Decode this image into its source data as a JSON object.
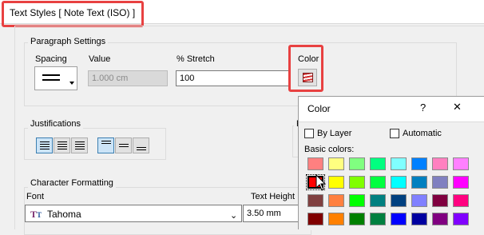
{
  "window": {
    "title": "Text Styles [ Note Text (ISO) ]"
  },
  "paragraph": {
    "group_label": "Paragraph Settings",
    "spacing_label": "Spacing",
    "value_label": "Value",
    "value": "1.000 cm",
    "stretch_label": "% Stretch",
    "stretch_value": "100",
    "color_label": "Color"
  },
  "justifications": {
    "group_label": "Justifications"
  },
  "partial_group_label": "P",
  "character": {
    "group_label": "Character Formatting",
    "font_label": "Font",
    "font_value": "Tahoma",
    "text_height_label": "Text Height",
    "text_height_value": "3.50 mm"
  },
  "color_popup": {
    "title": "Color",
    "help": "?",
    "close": "✕",
    "by_layer": "By Layer",
    "automatic": "Automatic",
    "basic_colors_label": "Basic colors:",
    "swatches": [
      [
        "#ff8080",
        "#ffff80",
        "#80ff80",
        "#00ff80",
        "#80ffff",
        "#0080ff",
        "#ff80c0",
        "#ff80ff"
      ],
      [
        "#ff0000",
        "#ffff00",
        "#80ff00",
        "#00ff40",
        "#00ffff",
        "#0080c0",
        "#8080c0",
        "#ff00ff"
      ],
      [
        "#804040",
        "#ff8040",
        "#00ff00",
        "#008080",
        "#004080",
        "#8080ff",
        "#800040",
        "#ff0080"
      ],
      [
        "#800000",
        "#ff8000",
        "#008000",
        "#008040",
        "#0000ff",
        "#0000a0",
        "#800080",
        "#8000ff"
      ]
    ]
  },
  "colors": {
    "highlight": "#e84141"
  }
}
